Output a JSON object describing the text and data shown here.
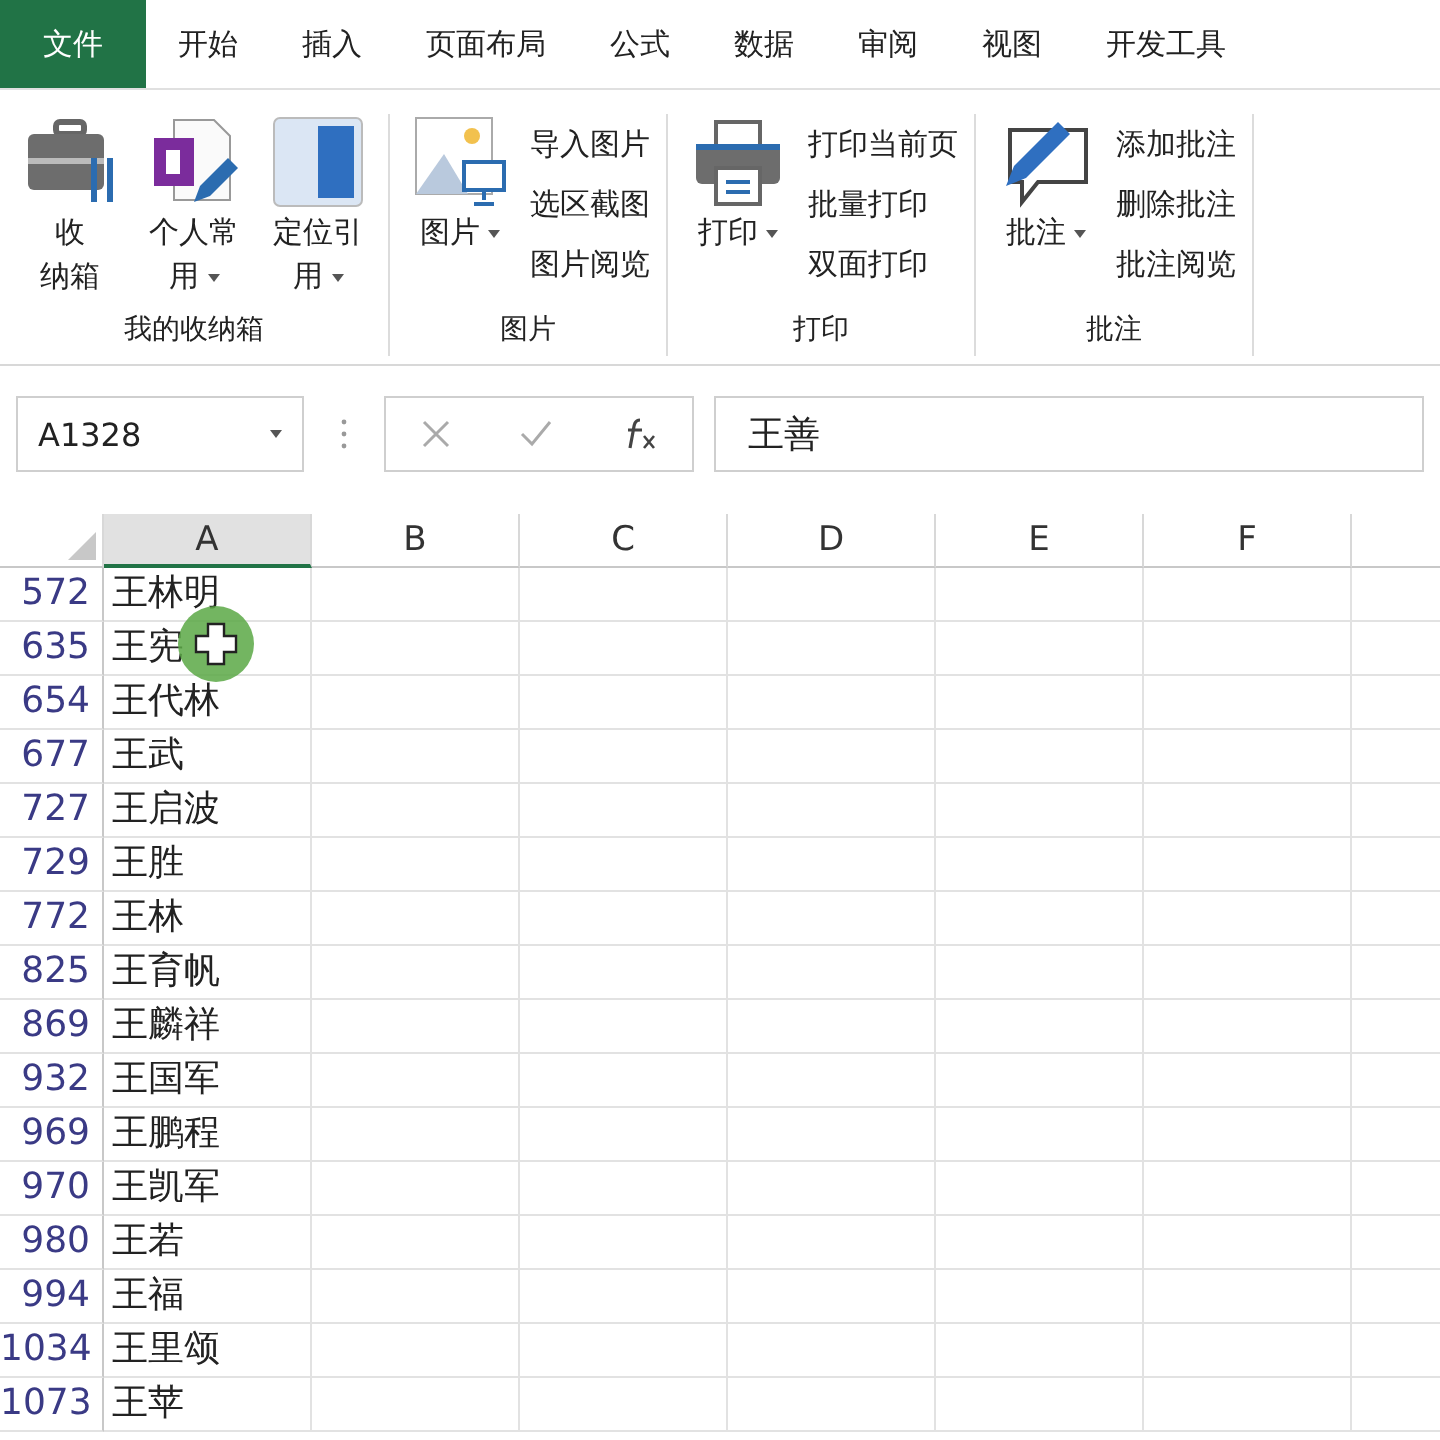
{
  "menu_tabs": [
    {
      "label": "文件",
      "selected": true
    },
    {
      "label": "开始",
      "selected": false
    },
    {
      "label": "插入",
      "selected": false
    },
    {
      "label": "页面布局",
      "selected": false
    },
    {
      "label": "公式",
      "selected": false
    },
    {
      "label": "数据",
      "selected": false
    },
    {
      "label": "审阅",
      "selected": false
    },
    {
      "label": "视图",
      "selected": false
    },
    {
      "label": "开发工具",
      "selected": false
    }
  ],
  "ribbon_groups": [
    {
      "name": "我的收纳箱",
      "large_buttons": [
        {
          "kind": "toolbox",
          "lines": [
            "收",
            "纳箱"
          ],
          "dropdown": false
        },
        {
          "kind": "document",
          "lines": [
            "个人常",
            "用"
          ],
          "dropdown": true
        },
        {
          "kind": "panel",
          "lines": [
            "定位引",
            "用"
          ],
          "dropdown": true
        }
      ]
    },
    {
      "name": "图片",
      "large_buttons": [
        {
          "kind": "picture",
          "lines": [
            "图片"
          ],
          "dropdown": true
        }
      ],
      "small_buttons": [
        "导入图片",
        "选区截图",
        "图片阅览"
      ]
    },
    {
      "name": "打印",
      "large_buttons": [
        {
          "kind": "printer",
          "lines": [
            "打印"
          ],
          "dropdown": true
        }
      ],
      "small_buttons": [
        "打印当前页",
        "批量打印",
        "双面打印"
      ]
    },
    {
      "name": "批注",
      "large_buttons": [
        {
          "kind": "comment",
          "lines": [
            "批注"
          ],
          "dropdown": true
        }
      ],
      "small_buttons": [
        "添加批注",
        "删除批注",
        "批注阅览"
      ]
    }
  ],
  "name_box": "A1328",
  "formula": "王善",
  "columns": [
    {
      "label": "A",
      "selected": true
    },
    {
      "label": "B",
      "selected": false
    },
    {
      "label": "C",
      "selected": false
    },
    {
      "label": "D",
      "selected": false
    },
    {
      "label": "E",
      "selected": false
    },
    {
      "label": "F",
      "selected": false
    }
  ],
  "rows": [
    {
      "number": "572",
      "value": "王林明"
    },
    {
      "number": "635",
      "value": "王宪"
    },
    {
      "number": "654",
      "value": "王代林"
    },
    {
      "number": "677",
      "value": "王武"
    },
    {
      "number": "727",
      "value": "王启波"
    },
    {
      "number": "729",
      "value": "王胜"
    },
    {
      "number": "772",
      "value": "王林"
    },
    {
      "number": "825",
      "value": "王育帆"
    },
    {
      "number": "869",
      "value": "王麟祥"
    },
    {
      "number": "932",
      "value": "王国军"
    },
    {
      "number": "969",
      "value": "王鹏程"
    },
    {
      "number": "970",
      "value": "王凯军"
    },
    {
      "number": "980",
      "value": "王若"
    },
    {
      "number": "994",
      "value": "王福"
    },
    {
      "number": "1034",
      "value": "王里颂"
    },
    {
      "number": "1073",
      "value": "王苹"
    }
  ]
}
